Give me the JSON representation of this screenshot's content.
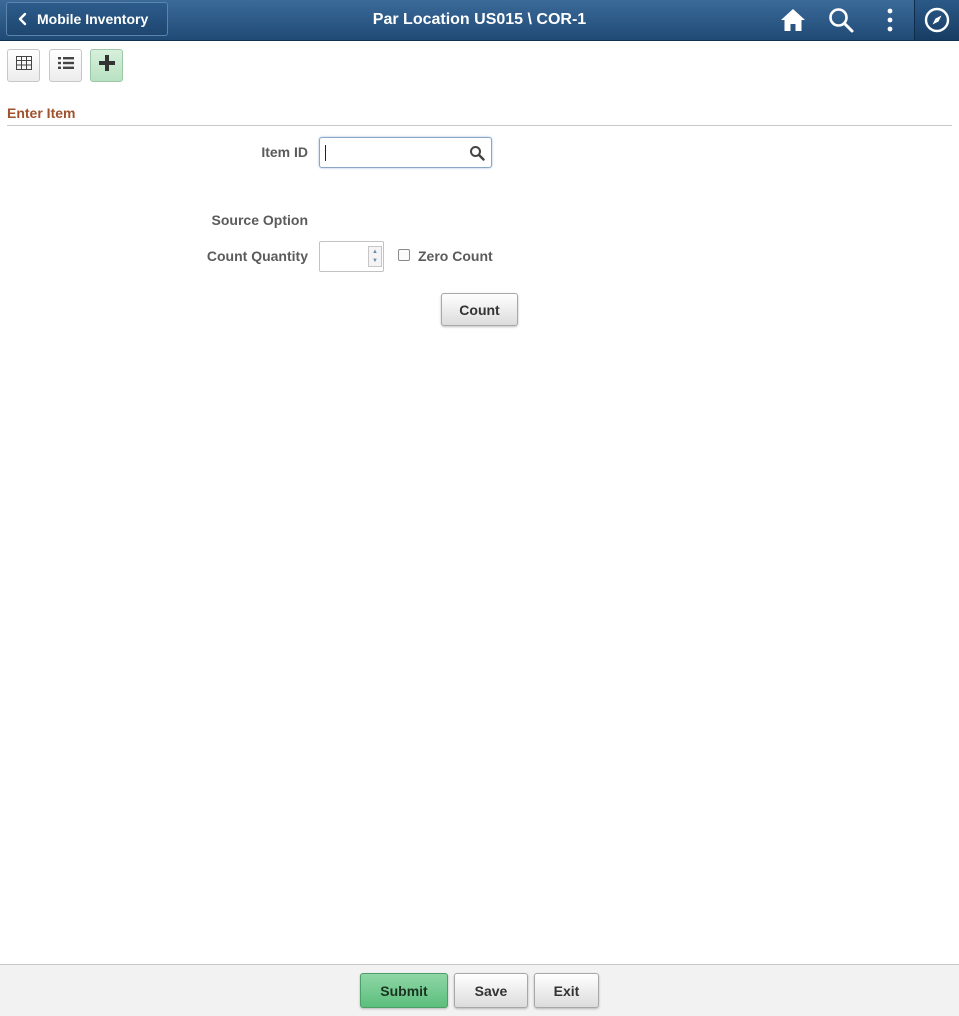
{
  "header": {
    "back_label": "Mobile Inventory",
    "title": "Par Location US015 \\ COR-1",
    "icons": [
      "home-icon",
      "search-icon",
      "actions-menu-icon",
      "navbar-compass-icon"
    ]
  },
  "toolbar": {
    "views": [
      "grid-view-icon",
      "list-view-icon",
      "add-item-icon"
    ],
    "active": "add-item-icon"
  },
  "section": {
    "title": "Enter Item"
  },
  "form": {
    "item_id_label": "Item ID",
    "item_id_value": "",
    "source_option_label": "Source Option",
    "count_quantity_label": "Count Quantity",
    "count_quantity_value": "",
    "zero_count_label": "Zero Count",
    "zero_count_checked": false,
    "count_button": "Count"
  },
  "footer": {
    "submit": "Submit",
    "save": "Save",
    "exit": "Exit"
  },
  "colors": {
    "banner": "#204a76",
    "section_title": "#a0522d",
    "primary_button": "#5cbf7d"
  }
}
